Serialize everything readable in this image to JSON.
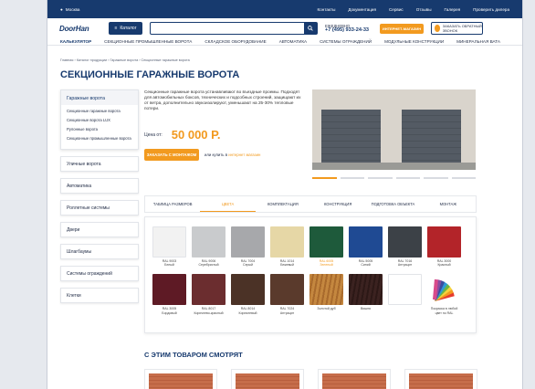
{
  "topbar": {
    "city": "Москва",
    "links": [
      "Контакты",
      "Документация",
      "Сервис",
      "Отзывы",
      "Галерея",
      "Проверить дилера"
    ]
  },
  "header": {
    "logo": "DoorHan",
    "catalog_label": "Каталог",
    "phone_caption": "ЕЖЕДНЕВНО",
    "phone": "+7 (495) 933-24-33",
    "shop_label": "ИНТЕРНЕТ-МАГАЗИН",
    "callback_label": "ЗАКАЗАТЬ ОБРАТНЫЙ ЗВОНОК"
  },
  "nav": [
    "КАЛЬКУЛЯТОР",
    "СЕКЦИОННЫЕ ПРОМЫШЛЕННЫЕ ВОРОТА",
    "СКЛАДСКОЕ ОБОРУДОВАНИЕ",
    "АВТОМАТИКА",
    "СИСТЕМЫ ОГРАЖДЕНИЙ",
    "МОДУЛЬНЫЕ КОНСТРУКЦИИ",
    "МИНЕРАЛЬНАЯ ВАТА"
  ],
  "breadcrumb": "Главная › Каталог продукции › Гаражные ворота › Секционные гаражные ворота",
  "page_title": "СЕКЦИОННЫЕ ГАРАЖНЫЕ ВОРОТА",
  "sidebar": {
    "open_head": "Гаражные ворота",
    "sub": [
      "Секционные гаражные ворота",
      "Секционные ворота LUX",
      "Рулонные ворота",
      "Секционные промышленные ворота"
    ],
    "items": [
      "Уличные ворота",
      "Автоматика",
      "Роллетные системы",
      "Двери",
      "Шлагбаумы",
      "Системы ограждений",
      "Клетки"
    ]
  },
  "description": "Секционные гаражные ворота устанавливают во въездные проемы. Подходят для автомобильных боксов, технических и подсобных строений, защищают их от ветра, дополнительно звукоизолируют, уменьшают на 25-30% тепловые потери.",
  "price": {
    "label": "Цена от:",
    "value": "50 000 Р."
  },
  "buy": {
    "button": "ЗАКАЗАТЬ С МОНТАЖОМ",
    "alt_prefix": "или купить в",
    "alt_link": "интернет магазин"
  },
  "tabs": [
    "ТАБЛИЦА РАЗМЕРОВ",
    "ЦВЕТА",
    "КОМПЛЕКТАЦИЯ",
    "КОНСТРУКЦИЯ",
    "ПОДГОТОВКА ОБЪЕКТА",
    "МОНТАЖ"
  ],
  "active_tab": 1,
  "colors": [
    {
      "code": "RAL 9003",
      "name": "Белый",
      "hex": "#f2f2f2"
    },
    {
      "code": "RAL 9006",
      "name": "Серебристый",
      "hex": "#c9cbcd"
    },
    {
      "code": "RAL 7004",
      "name": "Серый",
      "hex": "#a7a8ab"
    },
    {
      "code": "RAL 1014",
      "name": "Бежевый",
      "hex": "#e6d7a6"
    },
    {
      "code": "RAL 6005",
      "name": "Зеленый",
      "hex": "#1e5a3b"
    },
    {
      "code": "RAL 5005",
      "name": "Синий",
      "hex": "#1f4a93"
    },
    {
      "code": "RAL 7016",
      "name": "Антрацит",
      "hex": "#3c4147"
    },
    {
      "code": "RAL 3000",
      "name": "Красный",
      "hex": "#b32429"
    },
    {
      "code": "RAL 3005",
      "name": "Бордовый",
      "hex": "#5e1a25"
    },
    {
      "code": "RAL 8017",
      "name": "Коричнево-красный",
      "hex": "#6b2d2f"
    },
    {
      "code": "RAL 8014",
      "name": "Коричневый",
      "hex": "#4b3226"
    },
    {
      "code": "RAL 7024",
      "name": "Антрацит",
      "hex": "#5a3a2c"
    },
    {
      "code": "",
      "name": "Золотой дуб",
      "hex": "#b37a3c"
    },
    {
      "code": "",
      "name": "Вишня",
      "hex": "#3b2220"
    },
    {
      "code": "",
      "name": "",
      "hex": "#ffffff"
    },
    {
      "code": "",
      "name": "Покраска в любой цвет по RAL",
      "hex": "#ffffff"
    }
  ],
  "also_title": "С ЭТИМ ТОВАРОМ СМОТРЯТ"
}
